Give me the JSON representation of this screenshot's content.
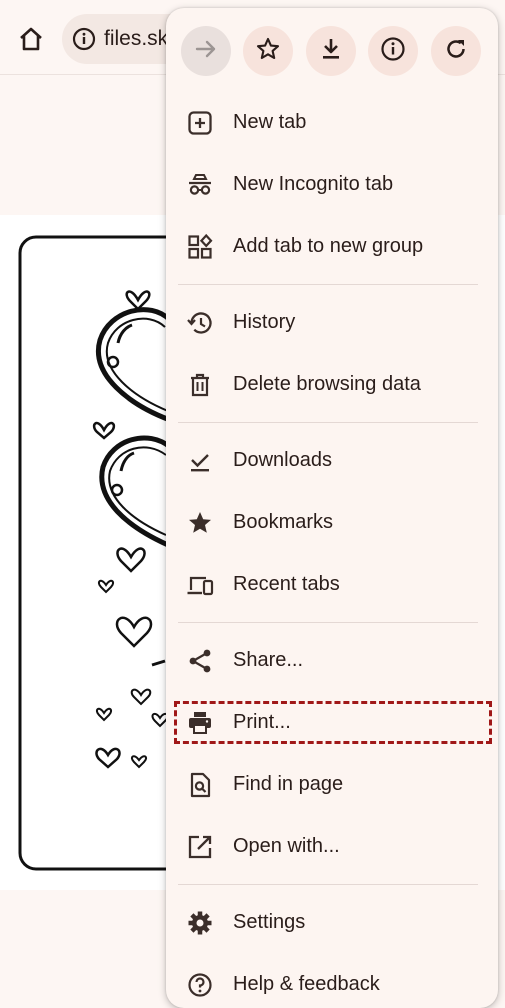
{
  "toolbar": {
    "url_text": "files.sk",
    "home_icon": "home-icon",
    "info_icon": "info-icon"
  },
  "top_actions": [
    {
      "name": "forward",
      "icon": "arrow-forward-icon",
      "enabled": false
    },
    {
      "name": "bookmark",
      "icon": "star-outline-icon",
      "enabled": true
    },
    {
      "name": "download",
      "icon": "download-icon",
      "enabled": true
    },
    {
      "name": "page-info",
      "icon": "info-icon",
      "enabled": true
    },
    {
      "name": "reload",
      "icon": "reload-icon",
      "enabled": true
    }
  ],
  "menu": {
    "items": [
      {
        "label": "New tab",
        "icon": "new-tab-icon"
      },
      {
        "label": "New Incognito tab",
        "icon": "incognito-icon"
      },
      {
        "label": "Add tab to new group",
        "icon": "tab-group-icon"
      },
      {
        "label": "History",
        "icon": "history-icon"
      },
      {
        "label": "Delete browsing data",
        "icon": "trash-icon"
      },
      {
        "label": "Downloads",
        "icon": "downloads-icon"
      },
      {
        "label": "Bookmarks",
        "icon": "star-icon"
      },
      {
        "label": "Recent tabs",
        "icon": "devices-icon"
      },
      {
        "label": "Share...",
        "icon": "share-icon"
      },
      {
        "label": "Print...",
        "icon": "print-icon"
      },
      {
        "label": "Find in page",
        "icon": "find-in-page-icon"
      },
      {
        "label": "Open with...",
        "icon": "open-external-icon"
      },
      {
        "label": "Settings",
        "icon": "gear-icon"
      },
      {
        "label": "Help & feedback",
        "icon": "help-icon"
      }
    ]
  },
  "colors": {
    "background": "#fdf6f3",
    "menu_bg": "#fdf5f1",
    "icon": "#3b2e2a",
    "highlight": "#a01818"
  }
}
